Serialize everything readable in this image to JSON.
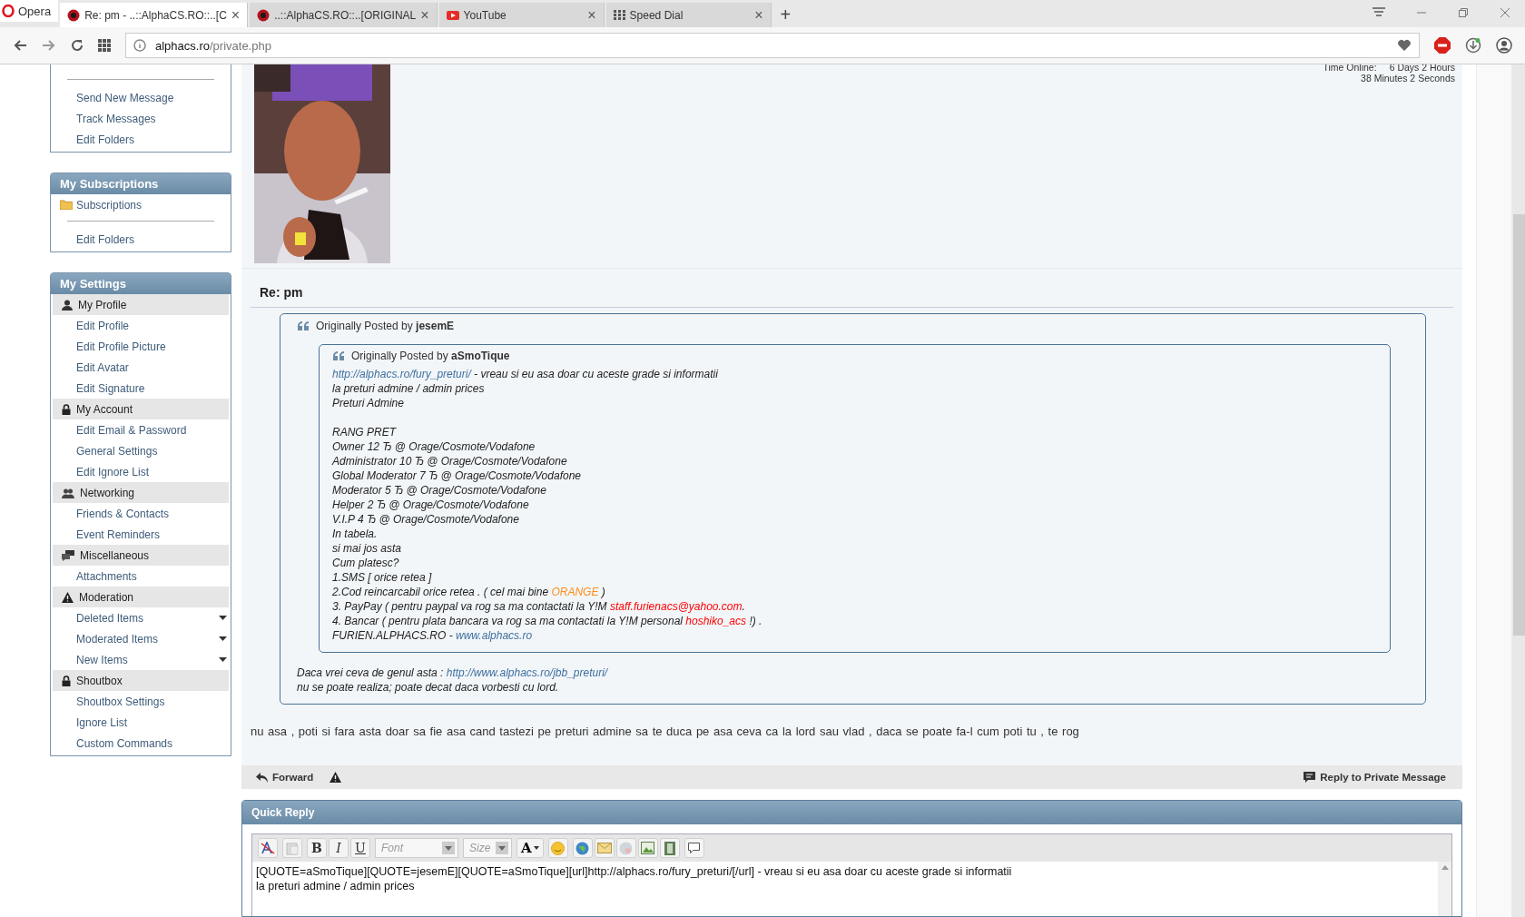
{
  "browser": {
    "menu_label": "Opera",
    "tabs": [
      {
        "title": "Re: pm - ..::AlphaCS.RO::..[C",
        "selected": true
      },
      {
        "title": "..::AlphaCS.RO::..[ORIGINAL",
        "selected": false
      },
      {
        "title": "YouTube",
        "selected": false
      },
      {
        "title": "Speed Dial",
        "selected": false
      }
    ],
    "new_tab": "+",
    "close": "×",
    "address": {
      "host": "alphacs.ro",
      "path": "/private.php"
    }
  },
  "sidebar": [
    {
      "items": [
        {
          "label": "Send New Message",
          "kind": "link",
          "divider_before": true
        },
        {
          "label": "Track Messages",
          "kind": "link"
        },
        {
          "label": "Edit Folders",
          "kind": "link"
        }
      ]
    },
    {
      "title": "My Subscriptions",
      "items": [
        {
          "label": "Subscriptions",
          "kind": "folder"
        },
        {
          "label": "Edit Folders",
          "kind": "link",
          "divider_before": true
        }
      ]
    },
    {
      "title": "My Settings",
      "items": [
        {
          "label": "My Profile",
          "kind": "section"
        },
        {
          "label": "Edit Profile",
          "kind": "link"
        },
        {
          "label": "Edit Profile Picture",
          "kind": "link"
        },
        {
          "label": "Edit Avatar",
          "kind": "link"
        },
        {
          "label": "Edit Signature",
          "kind": "link"
        },
        {
          "label": "My Account",
          "kind": "section"
        },
        {
          "label": "Edit Email & Password",
          "kind": "link"
        },
        {
          "label": "General Settings",
          "kind": "link"
        },
        {
          "label": "Edit Ignore List",
          "kind": "link"
        },
        {
          "label": "Networking",
          "kind": "section"
        },
        {
          "label": "Friends & Contacts",
          "kind": "link"
        },
        {
          "label": "Event Reminders",
          "kind": "link"
        },
        {
          "label": "Miscellaneous",
          "kind": "section"
        },
        {
          "label": "Attachments",
          "kind": "link"
        },
        {
          "label": "Moderation",
          "kind": "section"
        },
        {
          "label": "Deleted Items",
          "kind": "link",
          "has_menu": true
        },
        {
          "label": "Moderated Items",
          "kind": "link",
          "has_menu": true
        },
        {
          "label": "New Items",
          "kind": "link",
          "has_menu": true
        },
        {
          "label": "Shoutbox",
          "kind": "section"
        },
        {
          "label": "Shoutbox Settings",
          "kind": "link"
        },
        {
          "label": "Ignore List",
          "kind": "link"
        },
        {
          "label": "Custom Commands",
          "kind": "link"
        }
      ]
    }
  ],
  "post": {
    "time_online_label": "Time Online:",
    "time_online": [
      "6 Days 2 Hours",
      "38 Minutes 2 Seconds"
    ],
    "avatar": {
      "kind": "picture"
    },
    "title": "Re: pm",
    "quote": {
      "label": "Originally Posted by",
      "author": "jesemE",
      "inner": {
        "label": "Originally Posted by",
        "author": "aSmoTique",
        "lines": [
          {
            "segments": [
              {
                "kind": "link",
                "text": "http://alphacs.ro/fury_preturi/"
              },
              {
                "kind": "text",
                "text": " - vreau si eu asa doar cu aceste grade si informatii"
              }
            ]
          },
          {
            "segments": [
              {
                "kind": "text",
                "text": "la preturi admine / admin prices"
              }
            ]
          },
          {
            "segments": [
              {
                "kind": "text",
                "text": "Preturi Admine"
              }
            ]
          },
          {
            "gap_before": true,
            "segments": [
              {
                "kind": "text",
                "text": "RANG PRET"
              }
            ]
          },
          {
            "segments": [
              {
                "kind": "text",
                "text": "Owner 12 Ђ @ Orage/Cosmote/Vodafone"
              }
            ]
          },
          {
            "segments": [
              {
                "kind": "text",
                "text": "Administrator 10 Ђ @ Orage/Cosmote/Vodafone"
              }
            ]
          },
          {
            "segments": [
              {
                "kind": "text",
                "text": "Global Moderator 7 Ђ @ Orage/Cosmote/Vodafone"
              }
            ]
          },
          {
            "segments": [
              {
                "kind": "text",
                "text": "Moderator 5 Ђ @ Orage/Cosmote/Vodafone"
              }
            ]
          },
          {
            "segments": [
              {
                "kind": "text",
                "text": "Helper 2 Ђ @ Orage/Cosmote/Vodafone"
              }
            ]
          },
          {
            "segments": [
              {
                "kind": "text",
                "text": "V.I.P 4 Ђ @ Orage/Cosmote/Vodafone"
              }
            ]
          },
          {
            "segments": [
              {
                "kind": "text",
                "text": "In tabela."
              }
            ]
          },
          {
            "segments": [
              {
                "kind": "text",
                "text": "si mai jos asta"
              }
            ]
          },
          {
            "segments": [
              {
                "kind": "text",
                "text": "Cum platesc?"
              }
            ]
          },
          {
            "segments": [
              {
                "kind": "text",
                "text": "1.SMS [ orice retea ]"
              }
            ]
          },
          {
            "segments": [
              {
                "kind": "text",
                "text": "2.Cod reincarcabil orice retea . ( cel mai bine "
              },
              {
                "kind": "colored",
                "color": "#ff8c1a",
                "text": "ORANGE"
              },
              {
                "kind": "text",
                "text": " )"
              }
            ]
          },
          {
            "segments": [
              {
                "kind": "text",
                "text": "3. PayPay ( pentru paypal va rog sa ma contactati la Y!M "
              },
              {
                "kind": "colored",
                "color": "#ff0000",
                "text": "staff.furienacs@yahoo.com"
              },
              {
                "kind": "text",
                "text": "."
              }
            ]
          },
          {
            "segments": [
              {
                "kind": "text",
                "text": "4. Bancar ( pentru plata bancara va rog sa ma contactati la Y!M personal "
              },
              {
                "kind": "colored",
                "color": "#ff0000",
                "text": "hoshiko_acs"
              },
              {
                "kind": "text",
                "text": " !) ."
              }
            ]
          },
          {
            "segments": [
              {
                "kind": "text",
                "text": "FURIEN.ALPHACS.RO - "
              },
              {
                "kind": "link",
                "text": "www.alphacs.ro"
              }
            ]
          }
        ]
      },
      "lines": [
        {
          "segments": [
            {
              "kind": "text",
              "text": "Daca vrei ceva de genul asta : "
            },
            {
              "kind": "link",
              "text": "http://www.alphacs.ro/jbb_preturi/"
            }
          ]
        },
        {
          "segments": [
            {
              "kind": "text",
              "text": "nu se poate realiza; poate decat daca vorbesti cu lord."
            }
          ]
        }
      ]
    },
    "message": "nu asa , poti si fara asta doar sa fie asa cand tastezi pe preturi admine sa te duca pe asa ceva ca la lord sau vlad , daca se poate fa-l cum poti tu , te rog",
    "forward": "Forward",
    "reply": "Reply to Private Message"
  },
  "quick_reply": {
    "title": "Quick Reply",
    "format_buttons": [
      "B",
      "I",
      "U"
    ],
    "font_placeholder": "Font",
    "size_placeholder": "Size",
    "color_button": "A",
    "text": [
      "[QUOTE=aSmoTique][QUOTE=jesemE][QUOTE=aSmoTique][url]http://alphacs.ro/fury_preturi/[/url] - vreau si eu asa doar cu aceste grade si informatii",
      "la preturi admine / admin prices"
    ]
  }
}
